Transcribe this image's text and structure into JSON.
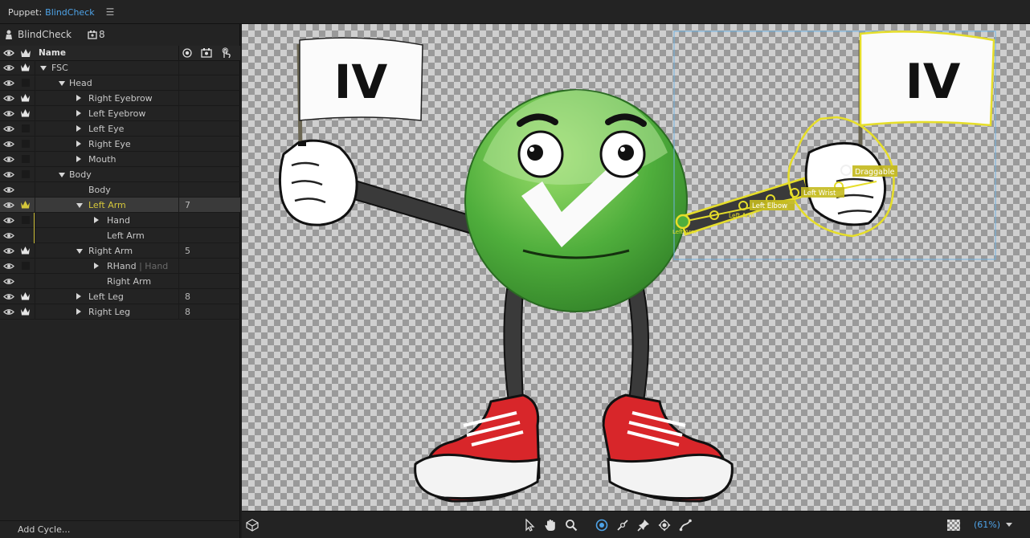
{
  "titlebar": {
    "prefix": "Puppet:",
    "puppet_name": "BlindCheck",
    "menu_icon": "hamburger-icon"
  },
  "panel": {
    "puppet_label": "BlindCheck",
    "count": "8",
    "column_name": "Name",
    "add_cycle": "Add Cycle..."
  },
  "rows": [
    {
      "name": "FSC",
      "indent": 0,
      "expander": "down",
      "crown": true,
      "num": ""
    },
    {
      "name": "Head",
      "indent": 1,
      "expander": "down",
      "crown": false,
      "num": ""
    },
    {
      "name": "Right Eyebrow",
      "indent": 2,
      "expander": "right",
      "crown": true,
      "num": ""
    },
    {
      "name": "Left Eyebrow",
      "indent": 2,
      "expander": "right",
      "crown": true,
      "num": ""
    },
    {
      "name": "Left Eye",
      "indent": 2,
      "expander": "right",
      "crown": false,
      "num": ""
    },
    {
      "name": "Right Eye",
      "indent": 2,
      "expander": "right",
      "crown": false,
      "num": ""
    },
    {
      "name": "Mouth",
      "indent": 2,
      "expander": "right",
      "crown": false,
      "num": ""
    },
    {
      "name": "Body",
      "indent": 1,
      "expander": "down",
      "crown": false,
      "num": ""
    },
    {
      "name": "Body",
      "indent": 2,
      "expander": "none",
      "crown": false,
      "noBox": true,
      "num": ""
    },
    {
      "name": "Left Arm",
      "indent": 2,
      "expander": "down",
      "crown": true,
      "selected": true,
      "num": "7"
    },
    {
      "name": "Hand",
      "indent": 3,
      "expander": "right",
      "crown": false,
      "yline": true,
      "num": ""
    },
    {
      "name": "Left Arm",
      "indent": 3,
      "expander": "none",
      "crown": false,
      "noBox": true,
      "yline": true,
      "num": ""
    },
    {
      "name": "Right Arm",
      "indent": 2,
      "expander": "down",
      "crown": true,
      "num": "5"
    },
    {
      "name": "RHand",
      "suffix": " | Hand",
      "indent": 3,
      "expander": "right",
      "crown": false,
      "num": ""
    },
    {
      "name": "Right Arm",
      "indent": 3,
      "expander": "none",
      "crown": false,
      "noBox": true,
      "num": ""
    },
    {
      "name": "Left Leg",
      "indent": 2,
      "expander": "right",
      "crown": true,
      "num": "8"
    },
    {
      "name": "Right Leg",
      "indent": 2,
      "expander": "right",
      "crown": true,
      "num": "8"
    }
  ],
  "canvas": {
    "flag_text": "IV",
    "bone_labels": {
      "draggable": "Draggable",
      "left_wrist": "Left Wrist",
      "left_elbow": "Left Elbow",
      "left_arm": "Left Arm"
    },
    "colors": {
      "handle": "#e6de2a",
      "selection": "#6fb2e0"
    }
  },
  "toolbar": {
    "zoom": "(61%)",
    "tools": [
      "select-tool-icon",
      "hand-tool-icon",
      "zoom-tool-icon",
      "origin-tool-icon",
      "stick-tool-icon",
      "pin-tool-icon",
      "handle-tool-icon",
      "dangle-tool-icon"
    ]
  }
}
